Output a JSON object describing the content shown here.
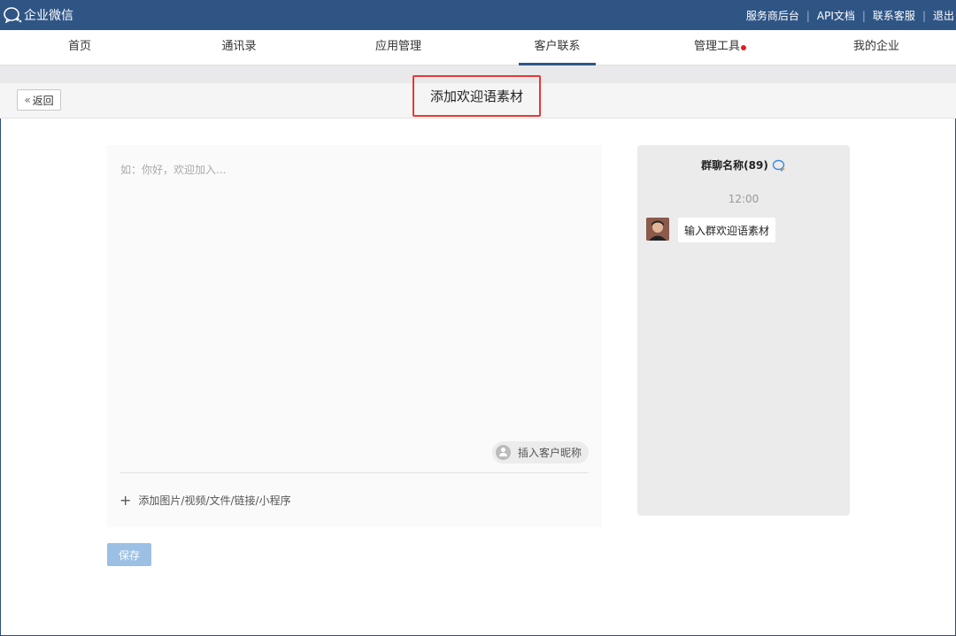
{
  "app": {
    "title": "企业微信"
  },
  "top_links": [
    "服务商后台",
    "API文档",
    "联系客服",
    "退出"
  ],
  "nav": {
    "items": [
      {
        "label": "首页"
      },
      {
        "label": "通讯录"
      },
      {
        "label": "应用管理"
      },
      {
        "label": "客户联系",
        "active": true
      },
      {
        "label": "管理工具",
        "badge": true
      },
      {
        "label": "我的企业"
      }
    ]
  },
  "page": {
    "back_label": "返回",
    "title": "添加欢迎语素材"
  },
  "editor": {
    "placeholder": "如：你好，欢迎加入...",
    "insert_nickname_label": "插入客户昵称",
    "add_media_label": "添加图片/视频/文件/链接/小程序"
  },
  "save_label": "保存",
  "preview": {
    "group_name": "群聊名称(89)",
    "time": "12:00",
    "message": "输入群欢迎语素材"
  },
  "colors": {
    "topbar": "#2f5585",
    "highlight_border": "#e53935",
    "save_button": "#9cc0e4",
    "badge_dot": "#e02020"
  }
}
